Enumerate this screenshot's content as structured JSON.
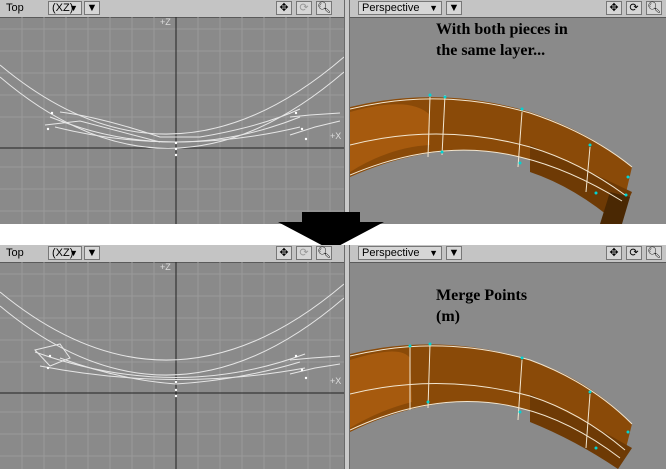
{
  "panels": [
    {
      "left_view": {
        "label": "Top",
        "axis_dropdown": "(XZ)",
        "axis_top": "+Z",
        "axis_right": "+X"
      },
      "right_view": {
        "dropdown": "Perspective"
      },
      "note": "With both pieces in\nthe same layer..."
    },
    {
      "left_view": {
        "label": "Top",
        "axis_dropdown": "(XZ)",
        "axis_top": "+Z",
        "axis_right": "+X"
      },
      "right_view": {
        "dropdown": "Perspective"
      },
      "note": "Merge Points\n(m)"
    }
  ],
  "icons": {
    "move": "move-icon",
    "rotate": "rotate-icon",
    "zoom": "zoom-icon",
    "menu": "viewport-menu-icon",
    "transition": "down-arrow-icon"
  },
  "colors": {
    "viewport_bg": "#8a8a8a",
    "grid": "#9a9a9a",
    "wire": "#e8e8e8",
    "model": "#8a4a08",
    "model_edge": "#f2e6d0",
    "points": "#00d4d4"
  }
}
